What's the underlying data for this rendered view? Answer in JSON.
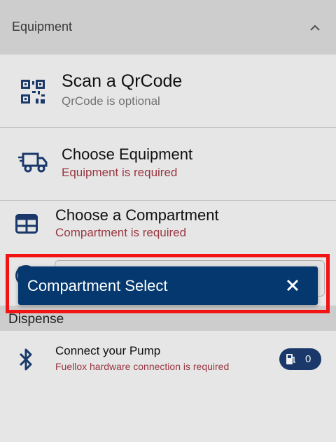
{
  "section": {
    "title": "Equipment",
    "icon": "chevron-up-icon"
  },
  "qrcode": {
    "title": "Scan a QrCode",
    "subtitle": "QrCode is optional",
    "icon": "qrcode-icon"
  },
  "equipment": {
    "title": "Choose Equipment",
    "subtitle": "Equipment is required",
    "icon": "truck-icon"
  },
  "compartment": {
    "title": "Choose a Compartment",
    "subtitle": "Compartment is required",
    "icon": "grid-icon"
  },
  "dispense": {
    "title": "Dispense"
  },
  "pump": {
    "title": "Connect your Pump",
    "subtitle": "Fuellox hardware connection is required",
    "icon": "bluetooth-icon",
    "badge_icon": "fuel-pump-icon",
    "badge_count": "0"
  },
  "dialog": {
    "title": "Compartment Select",
    "close_icon": "close-icon"
  },
  "colors": {
    "primary": "#04386f",
    "error": "#a23a46",
    "highlight": "#f21414",
    "header_bg": "#d8d8d8"
  }
}
